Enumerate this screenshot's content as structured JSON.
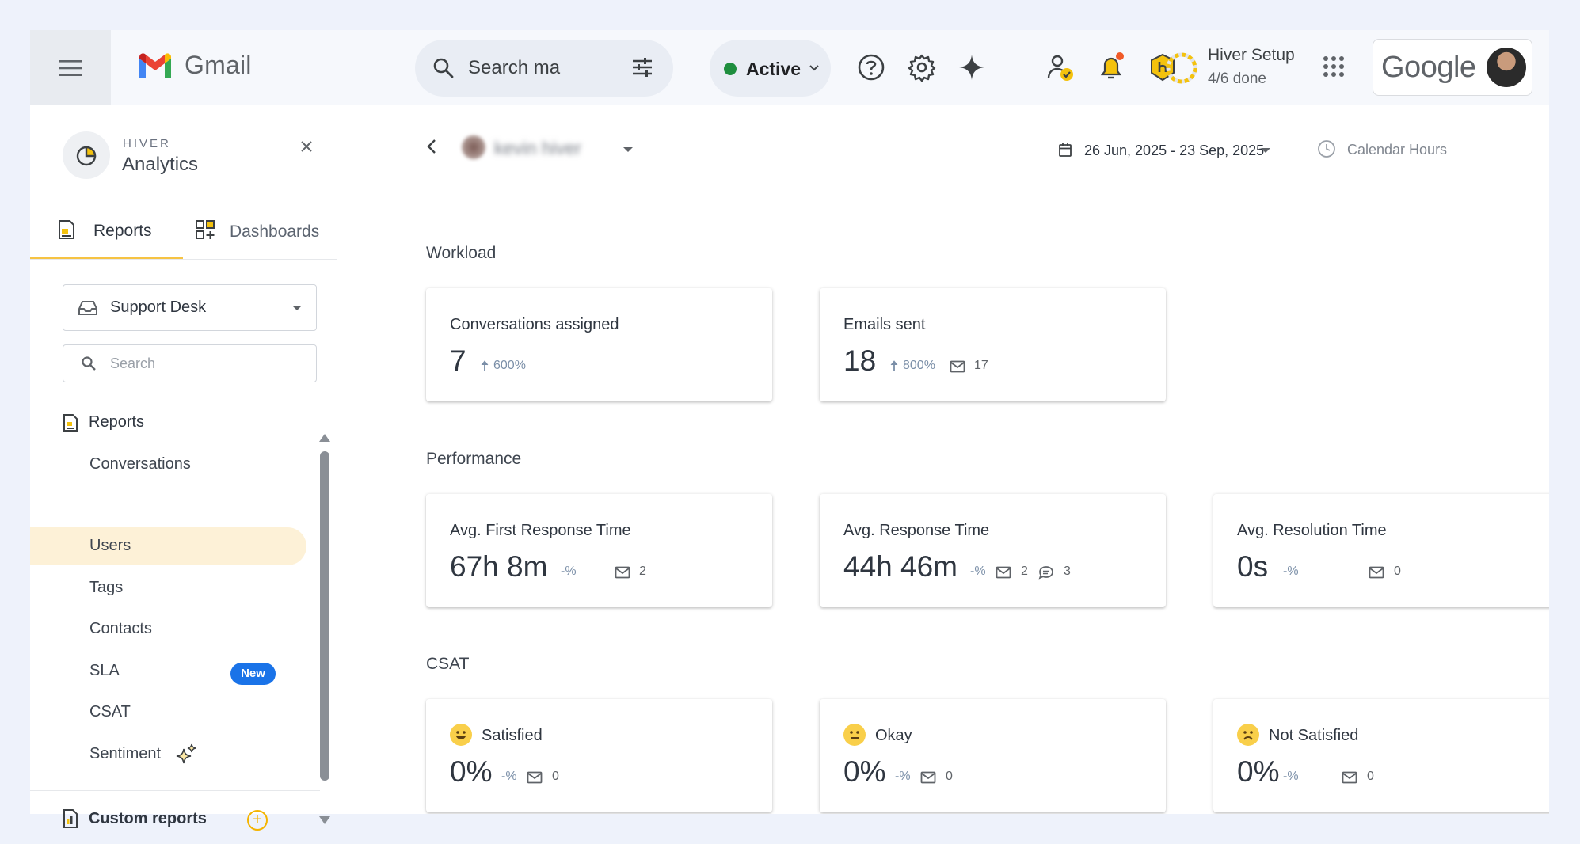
{
  "topbar": {
    "app_name": "Gmail",
    "search_placeholder": "Search ma",
    "status_label": "Active",
    "setup_title": "Hiver Setup",
    "setup_progress": "4/6 done",
    "google_label": "Google",
    "status_color": "#1e8e3e"
  },
  "sidebar": {
    "brand_small": "HIVER",
    "brand_big": "Analytics",
    "tabs": [
      {
        "label": "Reports",
        "active": true
      },
      {
        "label": "Dashboards",
        "active": false
      }
    ],
    "desk_select": "Support Desk",
    "search_placeholder": "Search",
    "section_label": "Reports",
    "items": [
      {
        "label": "Conversations",
        "selected": false
      },
      {
        "label": "Users",
        "selected": true
      },
      {
        "label": "Tags",
        "selected": false
      },
      {
        "label": "Contacts",
        "selected": false
      },
      {
        "label": "SLA",
        "badge": "New",
        "selected": false
      },
      {
        "label": "CSAT",
        "selected": false
      },
      {
        "label": "Sentiment",
        "selected": false
      }
    ],
    "custom_reports": "Custom reports",
    "accent": "#f6c343"
  },
  "main": {
    "user_name": "kevin hiver",
    "date_range": "26 Jun, 2025 - 23 Sep, 2025",
    "hours_mode": "Calendar Hours",
    "sections": {
      "workload": "Workload",
      "performance": "Performance",
      "csat": "CSAT"
    },
    "cards": {
      "conversations_assigned": {
        "title": "Conversations assigned",
        "value": "7",
        "change": "600%"
      },
      "emails_sent": {
        "title": "Emails sent",
        "value": "18",
        "change": "800%",
        "mail_count": "17"
      },
      "first_response": {
        "title": "Avg. First Response Time",
        "value": "67h 8m",
        "change": "-%",
        "mail_count": "2"
      },
      "response": {
        "title": "Avg. Response Time",
        "value": "44h 46m",
        "change": "-%",
        "mail_count": "2",
        "chat_count": "3"
      },
      "resolution": {
        "title": "Avg. Resolution Time",
        "value": "0s",
        "change": "-%",
        "mail_count": "0"
      },
      "satisfied": {
        "title": "Satisfied",
        "value": "0%",
        "change": "-%",
        "mail_count": "0"
      },
      "okay": {
        "title": "Okay",
        "value": "0%",
        "change": "-%",
        "mail_count": "0"
      },
      "not_satisfied": {
        "title": "Not Satisfied",
        "value": "0%",
        "change": "-%",
        "mail_count": "0"
      }
    }
  }
}
